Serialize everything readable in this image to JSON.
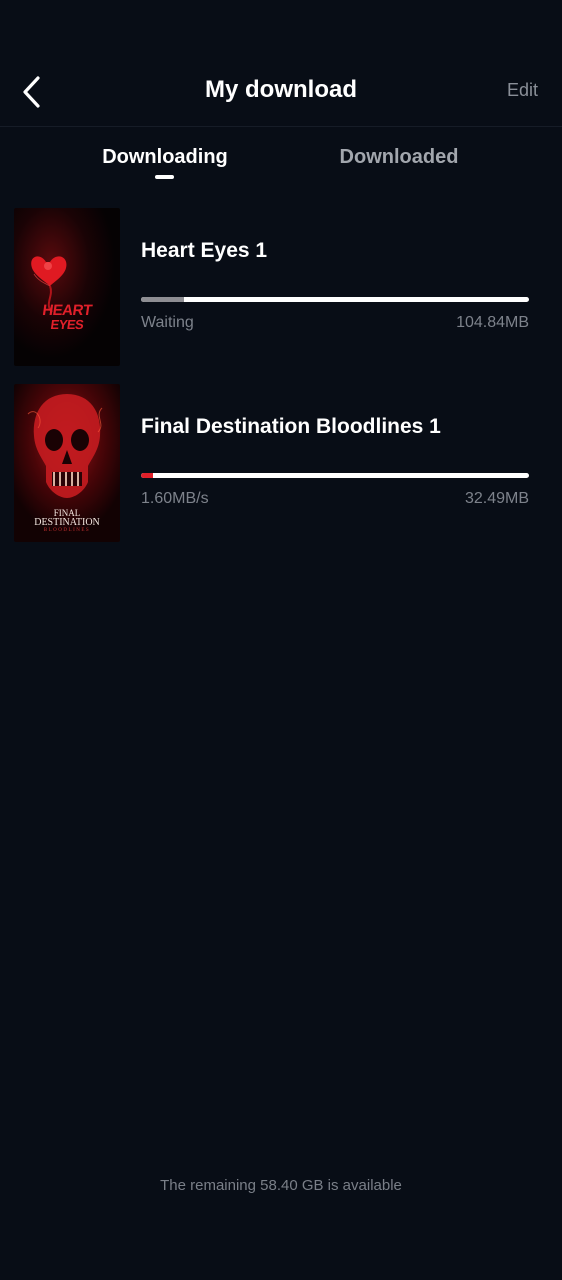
{
  "header": {
    "title": "My download",
    "edit_label": "Edit"
  },
  "tabs": [
    {
      "label": "Downloading",
      "active": true
    },
    {
      "label": "Downloaded",
      "active": false
    }
  ],
  "downloads": [
    {
      "title": "Heart Eyes 1",
      "status": "Waiting",
      "size": "104.84MB",
      "progress": 0.11,
      "progress_color": "#8e8e93",
      "poster_text": [
        "HEART",
        "EYES"
      ]
    },
    {
      "title": "Final Destination Bloodlines 1",
      "status": "1.60MB/s",
      "size": "32.49MB",
      "progress": 0.03,
      "progress_color": "#e0202a",
      "poster_text": [
        "FINAL",
        "DESTINATION",
        "BLOODLINES"
      ]
    }
  ],
  "footer": {
    "storage_note": "The remaining 58.40 GB is available"
  },
  "colors": {
    "background": "#080d16",
    "accent_red": "#e0202a"
  }
}
